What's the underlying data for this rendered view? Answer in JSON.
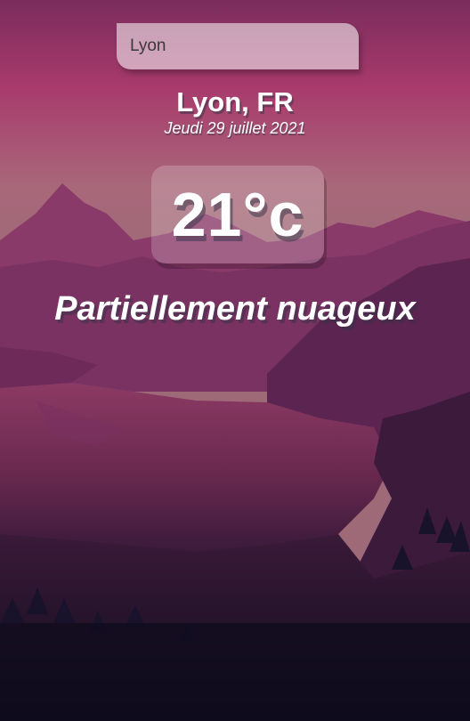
{
  "search": {
    "value": "Lyon",
    "placeholder": ""
  },
  "location": {
    "city": "Lyon, FR",
    "date": "Jeudi 29 juillet 2021"
  },
  "weather": {
    "temperature": "21°c",
    "condition": "Partiellement nuageux"
  },
  "colors": {
    "sky_top": "#852f62",
    "sky_glow": "#b05a7a",
    "horizon": "#a5607a",
    "lake": "#6a2a4e",
    "ground_dark": "#141020"
  }
}
